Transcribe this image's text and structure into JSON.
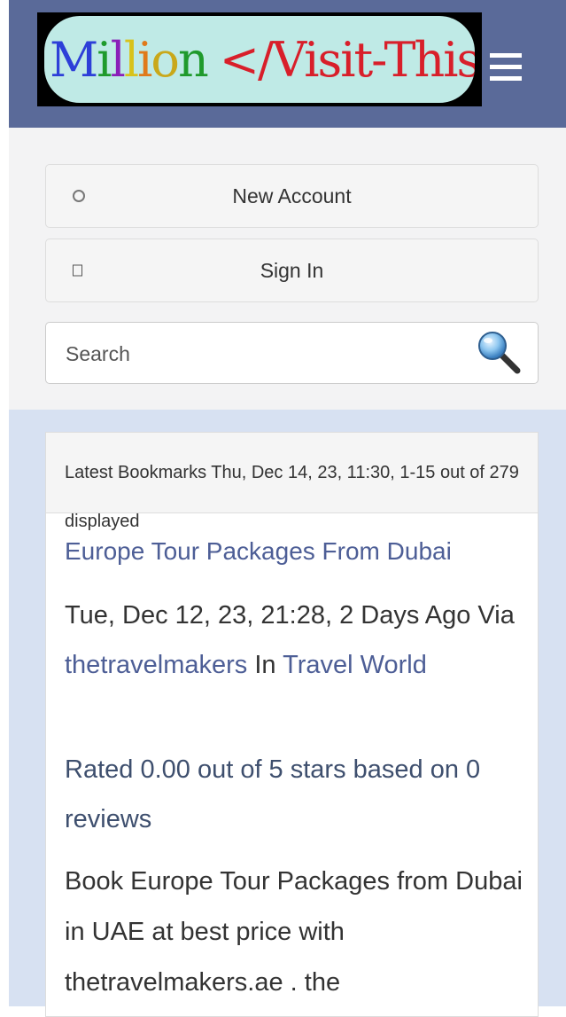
{
  "header": {
    "logo_parts": [
      "M",
      "i",
      "l",
      "l",
      "i",
      "o",
      "n"
    ],
    "logo_text_left": "Million",
    "logo_text_right": "</Visit-This>",
    "menu_icon": "hamburger-icon",
    "bg_color": "#5a6a99"
  },
  "account": {
    "new_account_label": "New Account",
    "new_account_icon": "gear-icon",
    "sign_in_label": "Sign In",
    "sign_in_icon": "box-icon"
  },
  "search": {
    "placeholder": "Search",
    "icon": "magnifier-icon"
  },
  "latest": {
    "heading": "Latest Bookmarks Thu, Dec 14, 23, 11:30, 1-15 out of 279 displayed"
  },
  "bookmark": {
    "title": "Europe Tour Packages From Dubai",
    "date_prefix": "Tue, Dec 12, 23, 21:28, 2 Days Ago Via ",
    "user": "thetravelmakers",
    "category_prefix": " In ",
    "category": "Travel World",
    "rating": "Rated 0.00 out of 5 stars based on 0 reviews",
    "description": "Book Europe Tour Packages from Dubai in UAE at best price with thetravelmakers.ae . the"
  },
  "colors": {
    "link": "#4d5e96",
    "band_top": "#f3f3f4",
    "band_main": "#d7e1f2"
  }
}
